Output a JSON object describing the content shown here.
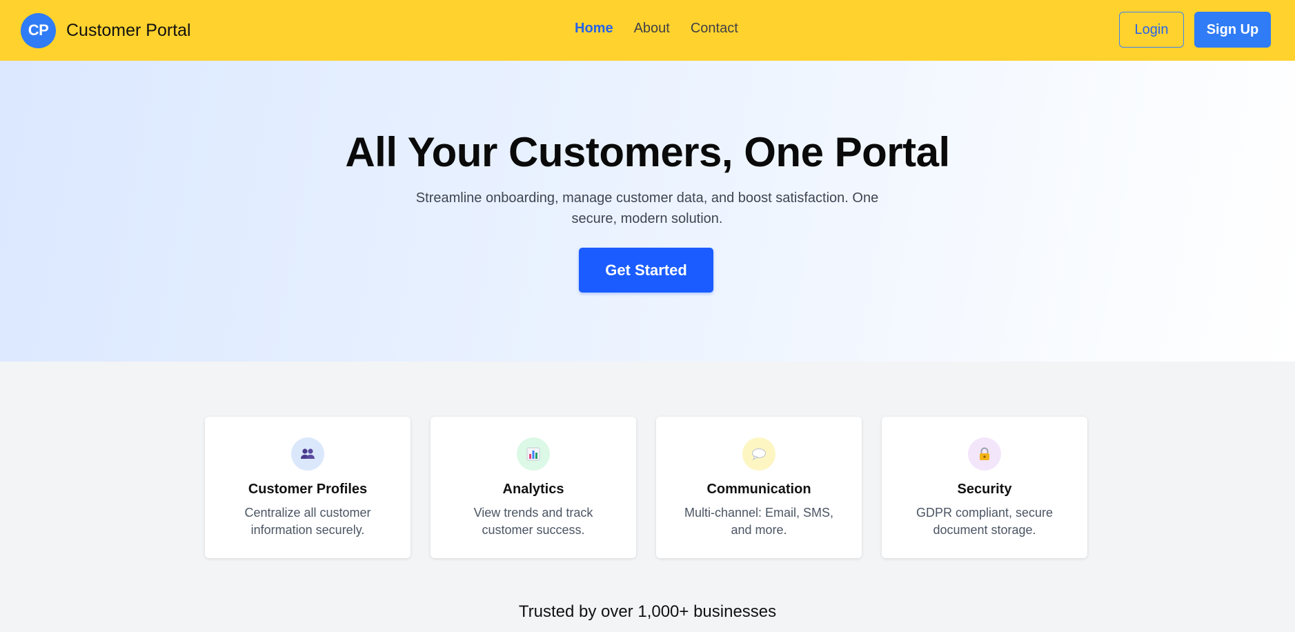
{
  "header": {
    "logo_text": "CP",
    "brand_name": "Customer Portal",
    "nav": [
      {
        "label": "Home",
        "active": true
      },
      {
        "label": "About",
        "active": false
      },
      {
        "label": "Contact",
        "active": false
      }
    ],
    "login_label": "Login",
    "signup_label": "Sign Up"
  },
  "hero": {
    "title": "All Your Customers, One Portal",
    "subtitle": "Streamline onboarding, manage customer data, and boost satisfaction. One secure, modern solution.",
    "cta_label": "Get Started"
  },
  "features": [
    {
      "icon": "users-icon",
      "title": "Customer Profiles",
      "description": "Centralize all customer information securely.",
      "icon_bg": "#dbe8fb"
    },
    {
      "icon": "bar-chart-icon",
      "title": "Analytics",
      "description": "View trends and track customer success.",
      "icon_bg": "#dcf8e6"
    },
    {
      "icon": "speech-bubble-icon",
      "title": "Communication",
      "description": "Multi-channel: Email, SMS, and more.",
      "icon_bg": "#fdf6c3"
    },
    {
      "icon": "lock-icon",
      "title": "Security",
      "description": "GDPR compliant, secure document storage.",
      "icon_bg": "#f3e6fb"
    }
  ],
  "trusted_text": "Trusted by over 1,000+ businesses",
  "colors": {
    "header_bg": "#ffd22e",
    "accent": "#2f7cf6",
    "cta": "#1a5cff",
    "active_nav": "#2563eb"
  }
}
